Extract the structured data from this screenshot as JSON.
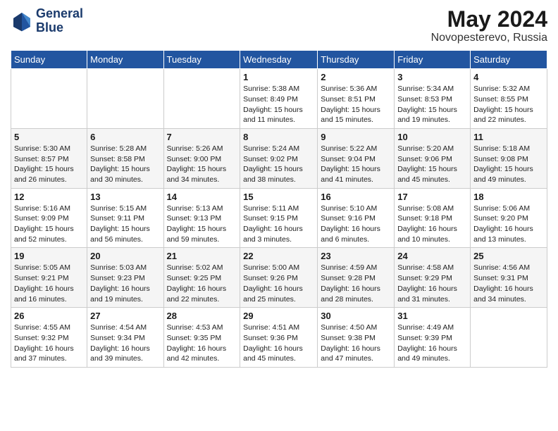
{
  "header": {
    "logo_line1": "General",
    "logo_line2": "Blue",
    "month": "May 2024",
    "location": "Novopesterevo, Russia"
  },
  "weekdays": [
    "Sunday",
    "Monday",
    "Tuesday",
    "Wednesday",
    "Thursday",
    "Friday",
    "Saturday"
  ],
  "weeks": [
    [
      {
        "day": "",
        "info": ""
      },
      {
        "day": "",
        "info": ""
      },
      {
        "day": "",
        "info": ""
      },
      {
        "day": "1",
        "info": "Sunrise: 5:38 AM\nSunset: 8:49 PM\nDaylight: 15 hours\nand 11 minutes."
      },
      {
        "day": "2",
        "info": "Sunrise: 5:36 AM\nSunset: 8:51 PM\nDaylight: 15 hours\nand 15 minutes."
      },
      {
        "day": "3",
        "info": "Sunrise: 5:34 AM\nSunset: 8:53 PM\nDaylight: 15 hours\nand 19 minutes."
      },
      {
        "day": "4",
        "info": "Sunrise: 5:32 AM\nSunset: 8:55 PM\nDaylight: 15 hours\nand 22 minutes."
      }
    ],
    [
      {
        "day": "5",
        "info": "Sunrise: 5:30 AM\nSunset: 8:57 PM\nDaylight: 15 hours\nand 26 minutes."
      },
      {
        "day": "6",
        "info": "Sunrise: 5:28 AM\nSunset: 8:58 PM\nDaylight: 15 hours\nand 30 minutes."
      },
      {
        "day": "7",
        "info": "Sunrise: 5:26 AM\nSunset: 9:00 PM\nDaylight: 15 hours\nand 34 minutes."
      },
      {
        "day": "8",
        "info": "Sunrise: 5:24 AM\nSunset: 9:02 PM\nDaylight: 15 hours\nand 38 minutes."
      },
      {
        "day": "9",
        "info": "Sunrise: 5:22 AM\nSunset: 9:04 PM\nDaylight: 15 hours\nand 41 minutes."
      },
      {
        "day": "10",
        "info": "Sunrise: 5:20 AM\nSunset: 9:06 PM\nDaylight: 15 hours\nand 45 minutes."
      },
      {
        "day": "11",
        "info": "Sunrise: 5:18 AM\nSunset: 9:08 PM\nDaylight: 15 hours\nand 49 minutes."
      }
    ],
    [
      {
        "day": "12",
        "info": "Sunrise: 5:16 AM\nSunset: 9:09 PM\nDaylight: 15 hours\nand 52 minutes."
      },
      {
        "day": "13",
        "info": "Sunrise: 5:15 AM\nSunset: 9:11 PM\nDaylight: 15 hours\nand 56 minutes."
      },
      {
        "day": "14",
        "info": "Sunrise: 5:13 AM\nSunset: 9:13 PM\nDaylight: 15 hours\nand 59 minutes."
      },
      {
        "day": "15",
        "info": "Sunrise: 5:11 AM\nSunset: 9:15 PM\nDaylight: 16 hours\nand 3 minutes."
      },
      {
        "day": "16",
        "info": "Sunrise: 5:10 AM\nSunset: 9:16 PM\nDaylight: 16 hours\nand 6 minutes."
      },
      {
        "day": "17",
        "info": "Sunrise: 5:08 AM\nSunset: 9:18 PM\nDaylight: 16 hours\nand 10 minutes."
      },
      {
        "day": "18",
        "info": "Sunrise: 5:06 AM\nSunset: 9:20 PM\nDaylight: 16 hours\nand 13 minutes."
      }
    ],
    [
      {
        "day": "19",
        "info": "Sunrise: 5:05 AM\nSunset: 9:21 PM\nDaylight: 16 hours\nand 16 minutes."
      },
      {
        "day": "20",
        "info": "Sunrise: 5:03 AM\nSunset: 9:23 PM\nDaylight: 16 hours\nand 19 minutes."
      },
      {
        "day": "21",
        "info": "Sunrise: 5:02 AM\nSunset: 9:25 PM\nDaylight: 16 hours\nand 22 minutes."
      },
      {
        "day": "22",
        "info": "Sunrise: 5:00 AM\nSunset: 9:26 PM\nDaylight: 16 hours\nand 25 minutes."
      },
      {
        "day": "23",
        "info": "Sunrise: 4:59 AM\nSunset: 9:28 PM\nDaylight: 16 hours\nand 28 minutes."
      },
      {
        "day": "24",
        "info": "Sunrise: 4:58 AM\nSunset: 9:29 PM\nDaylight: 16 hours\nand 31 minutes."
      },
      {
        "day": "25",
        "info": "Sunrise: 4:56 AM\nSunset: 9:31 PM\nDaylight: 16 hours\nand 34 minutes."
      }
    ],
    [
      {
        "day": "26",
        "info": "Sunrise: 4:55 AM\nSunset: 9:32 PM\nDaylight: 16 hours\nand 37 minutes."
      },
      {
        "day": "27",
        "info": "Sunrise: 4:54 AM\nSunset: 9:34 PM\nDaylight: 16 hours\nand 39 minutes."
      },
      {
        "day": "28",
        "info": "Sunrise: 4:53 AM\nSunset: 9:35 PM\nDaylight: 16 hours\nand 42 minutes."
      },
      {
        "day": "29",
        "info": "Sunrise: 4:51 AM\nSunset: 9:36 PM\nDaylight: 16 hours\nand 45 minutes."
      },
      {
        "day": "30",
        "info": "Sunrise: 4:50 AM\nSunset: 9:38 PM\nDaylight: 16 hours\nand 47 minutes."
      },
      {
        "day": "31",
        "info": "Sunrise: 4:49 AM\nSunset: 9:39 PM\nDaylight: 16 hours\nand 49 minutes."
      },
      {
        "day": "",
        "info": ""
      }
    ]
  ]
}
